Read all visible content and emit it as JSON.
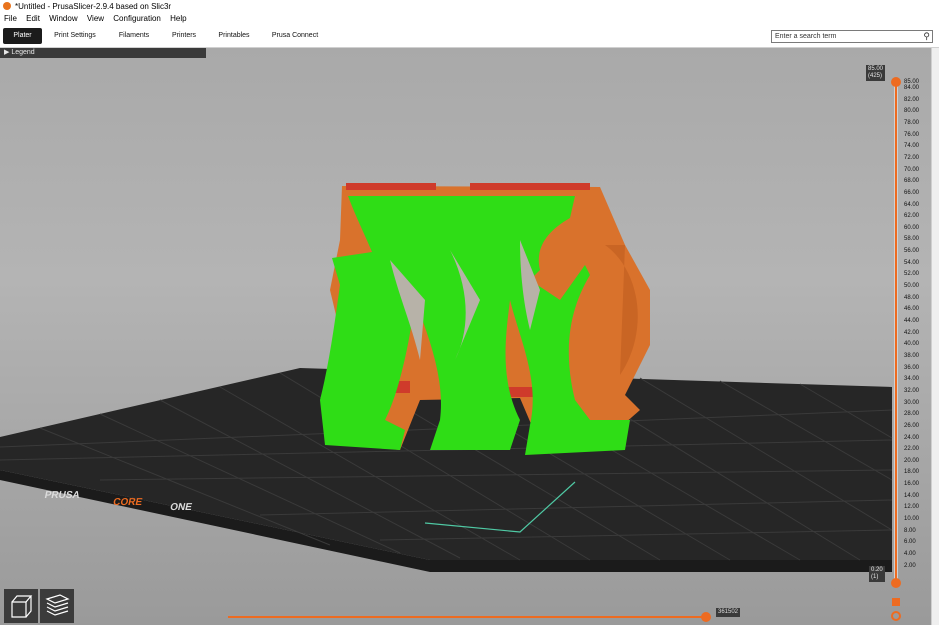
{
  "window": {
    "title": "*Untitled - PrusaSlicer-2.9.4 based on Slic3r"
  },
  "menu": [
    "File",
    "Edit",
    "Window",
    "View",
    "Configuration",
    "Help"
  ],
  "tabs": [
    {
      "label": "Plater",
      "active": true
    },
    {
      "label": "Print Settings",
      "active": false
    },
    {
      "label": "Filaments",
      "active": false
    },
    {
      "label": "Printers",
      "active": false
    },
    {
      "label": "Printables",
      "active": false
    },
    {
      "label": "Prusa Connect",
      "active": false
    }
  ],
  "search": {
    "placeholder": "Enter a search term"
  },
  "legend": {
    "label": "Legend"
  },
  "bed": {
    "brand_text_1": "PRUSA",
    "brand_text_2": "CORE",
    "brand_text_3": "ONE"
  },
  "layer_slider": {
    "top_height": "85.00",
    "top_layer": "(425)",
    "bottom_height": "0.20",
    "bottom_layer": "(1)",
    "ticks": [
      "85.00",
      "84.00",
      "82.00",
      "80.00",
      "78.00",
      "76.00",
      "74.00",
      "72.00",
      "70.00",
      "68.00",
      "66.00",
      "64.00",
      "62.00",
      "60.00",
      "58.00",
      "56.00",
      "54.00",
      "52.00",
      "50.00",
      "48.00",
      "46.00",
      "44.00",
      "42.00",
      "40.00",
      "38.00",
      "36.00",
      "34.00",
      "32.00",
      "30.00",
      "28.00",
      "26.00",
      "24.00",
      "22.00",
      "20.00",
      "18.00",
      "16.00",
      "14.00",
      "12.00",
      "10.00",
      "8.00",
      "6.00",
      "4.00",
      "2.00"
    ]
  },
  "horizontal_slider": {
    "value": "361502"
  },
  "colors": {
    "accent": "#ed6b21",
    "support": "#26e01a",
    "part": "#d9722c",
    "bed": "#262626"
  }
}
